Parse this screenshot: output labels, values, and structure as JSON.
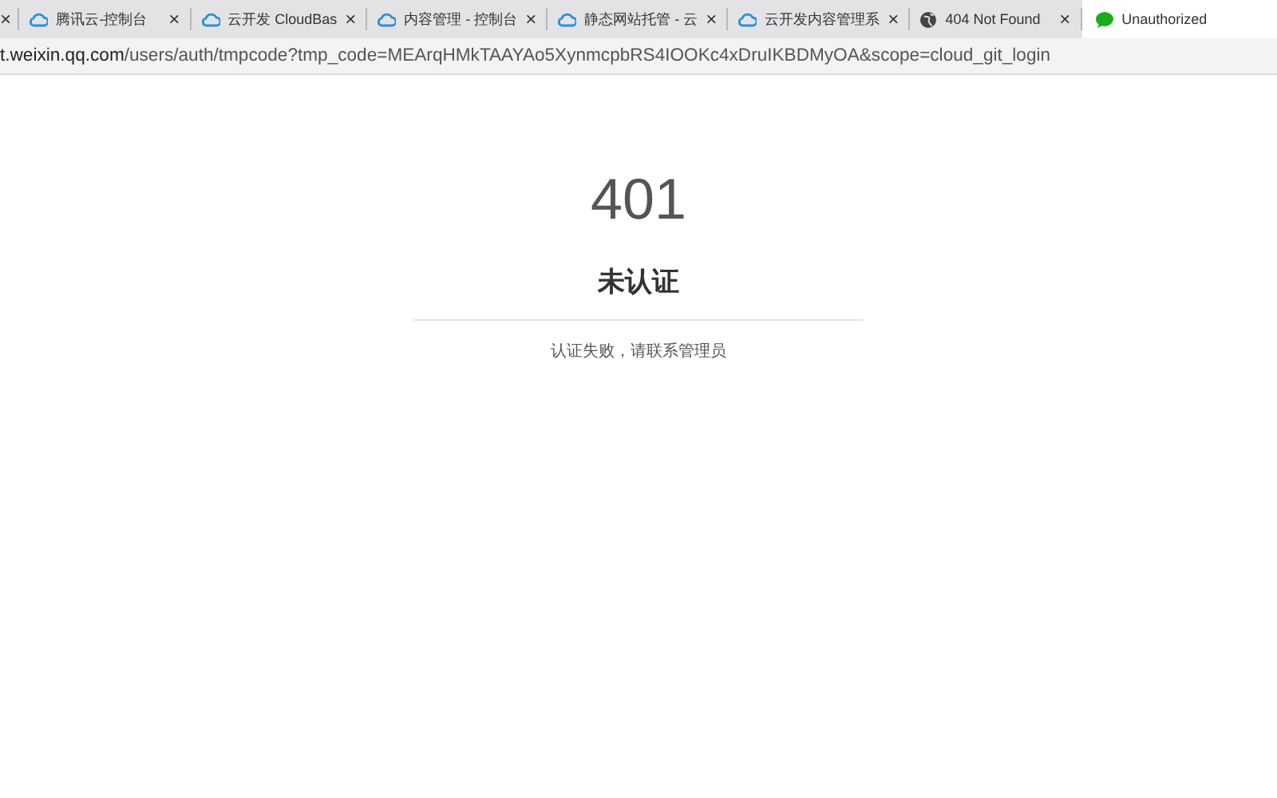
{
  "tab_fragment": {
    "close": "×"
  },
  "tabs": [
    {
      "kind": "cloud",
      "label": "腾讯云-控制台",
      "close": "×",
      "selected": false
    },
    {
      "kind": "cloud",
      "label": "云开发 CloudBas",
      "close": "×",
      "selected": false
    },
    {
      "kind": "cloud",
      "label": "内容管理 - 控制台",
      "close": "×",
      "selected": false
    },
    {
      "kind": "cloud",
      "label": "静态网站托管 - 云",
      "close": "×",
      "selected": false
    },
    {
      "kind": "cloud",
      "label": "云开发内容管理系",
      "close": "×",
      "selected": false
    },
    {
      "kind": "globe",
      "label": "404 Not Found",
      "close": "×",
      "selected": false
    },
    {
      "kind": "chat",
      "label": "Unauthorized",
      "selected": true
    }
  ],
  "address_bar": {
    "host": "t.weixin.qq.com",
    "path": "/users/auth/tmpcode?tmp_code=MEArqHMkTAAYAo5XynmcpbRS4IOOKc4xDruIKBDMyOA&scope=cloud_git_login"
  },
  "page": {
    "code": "401",
    "title": "未认证",
    "message": "认证失败，请联系管理员"
  }
}
